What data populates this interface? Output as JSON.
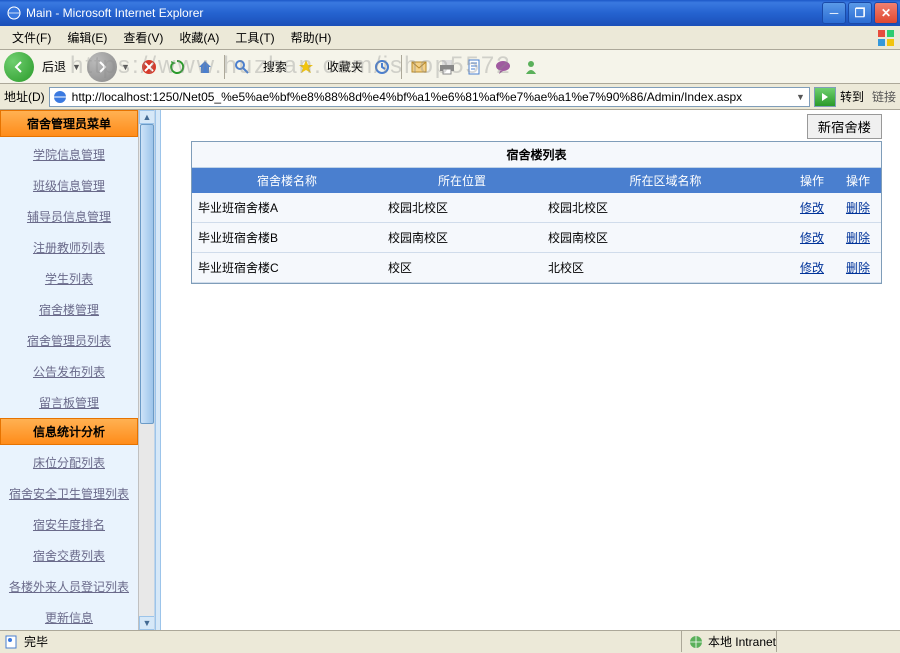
{
  "window": {
    "title": "Main - Microsoft Internet Explorer"
  },
  "menu": {
    "items": [
      "文件(F)",
      "编辑(E)",
      "查看(V)",
      "收藏(A)",
      "工具(T)",
      "帮助(H)"
    ]
  },
  "toolbar": {
    "back": "后退",
    "search": "搜索",
    "favorites": "收藏夹"
  },
  "addressbar": {
    "label": "地址(D)",
    "url": "http://localhost:1250/Net05_%e5%ae%bf%e8%88%8d%e4%bf%a1%e6%81%af%e7%ae%a1%e7%90%86/Admin/Index.aspx",
    "go": "转到",
    "links": "链接"
  },
  "watermark": "https://www.huzhan.com/ishop5572",
  "sidebar": {
    "cat1": "宿舍管理员菜单",
    "links1": [
      "学院信息管理",
      "班级信息管理",
      "辅导员信息管理",
      "注册教师列表",
      "学生列表",
      "宿舍楼管理",
      "宿舍管理员列表",
      "公告发布列表",
      "留言板管理"
    ],
    "cat2": "信息统计分析",
    "links2": [
      "床位分配列表",
      "宿舍安全卫生管理列表",
      "宿安年度排名",
      "宿舍交费列表",
      "各楼外来人员登记列表",
      "更新信息"
    ]
  },
  "main": {
    "new_button": "新宿舍楼",
    "caption": "宿舍楼列表",
    "headers": [
      "宿舍楼名称",
      "所在位置",
      "所在区域名称",
      "操作",
      "操作"
    ],
    "rows": [
      {
        "name": "毕业班宿舍楼A",
        "loc": "校园北校区",
        "area": "校园北校区",
        "op1": "修改",
        "op2": "删除"
      },
      {
        "name": "毕业班宿舍楼B",
        "loc": "校园南校区",
        "area": "校园南校区",
        "op1": "修改",
        "op2": "删除"
      },
      {
        "name": "毕业班宿舍楼C",
        "loc": "校区",
        "area": "北校区",
        "op1": "修改",
        "op2": "删除"
      }
    ]
  },
  "statusbar": {
    "done": "完毕",
    "zone": "本地 Intranet"
  }
}
